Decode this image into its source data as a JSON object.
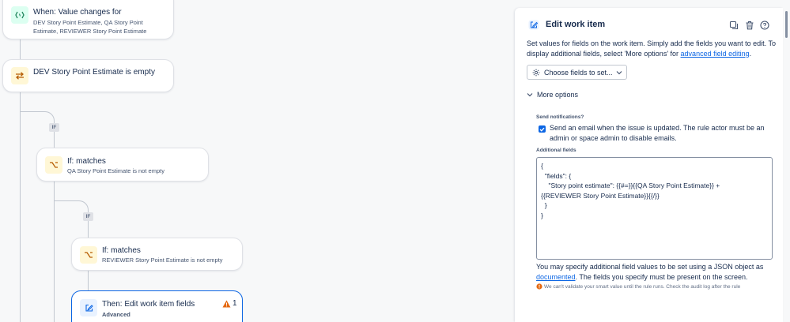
{
  "canvas": {
    "trigger_card": {
      "title": "When: Value changes for",
      "subtitle": "DEV Story Point Estimate, QA Story Point Estimate, REVIEWER Story Point Estimate",
      "icon": "code-brackets-icon"
    },
    "condition_card": {
      "title": "DEV Story Point Estimate is empty",
      "icon": "swap-arrows-icon"
    },
    "if_tag_1": "IF",
    "if_card_1": {
      "title": "If: matches",
      "subtitle": "QA Story Point Estimate is not empty",
      "icon": "branch-icon"
    },
    "if_tag_2": "IF",
    "if_card_2": {
      "title": "If: matches",
      "subtitle": "REVIEWER Story Point Estimate is not empty",
      "icon": "branch-icon"
    },
    "action_card": {
      "title": "Then: Edit work item fields",
      "subtitle": "Advanced",
      "warning_count": "1",
      "icon": "edit-icon"
    }
  },
  "panel": {
    "title": "Edit work item",
    "description_prefix": "Set values for fields on the work item. Simply add the fields you want to edit. To display additional fields, select 'More options' for ",
    "description_link": "advanced field editing",
    "description_suffix": ".",
    "choose_fields_label": "Choose fields to set...",
    "more_options_label": "More options",
    "send_notifications_label": "Send notifications?",
    "send_email_checked": true,
    "send_email_text": "Send an email when the issue is updated. The rule actor must be an admin or space admin to disable emails.",
    "additional_fields_label": "Additional fields",
    "additional_fields_value": "{\n  \"fields\": {\n    \"Story point estimate\": {{#=}}{{QA Story Point Estimate}} +\n{{REVIEWER Story Point Estimate}}{{/}}\n  }\n}",
    "specify_prefix": "You may specify additional field values to be set using a JSON object as ",
    "specify_link": "documented",
    "specify_suffix": ". The fields you specify must be present on the screen.",
    "warning_text": "We can't validate your smart value until the rule runs. Check the audit log after the rule"
  },
  "colors": {
    "accent": "#0c66e4",
    "warning": "#e56910",
    "canvas_bg": "#f7f8f9"
  }
}
